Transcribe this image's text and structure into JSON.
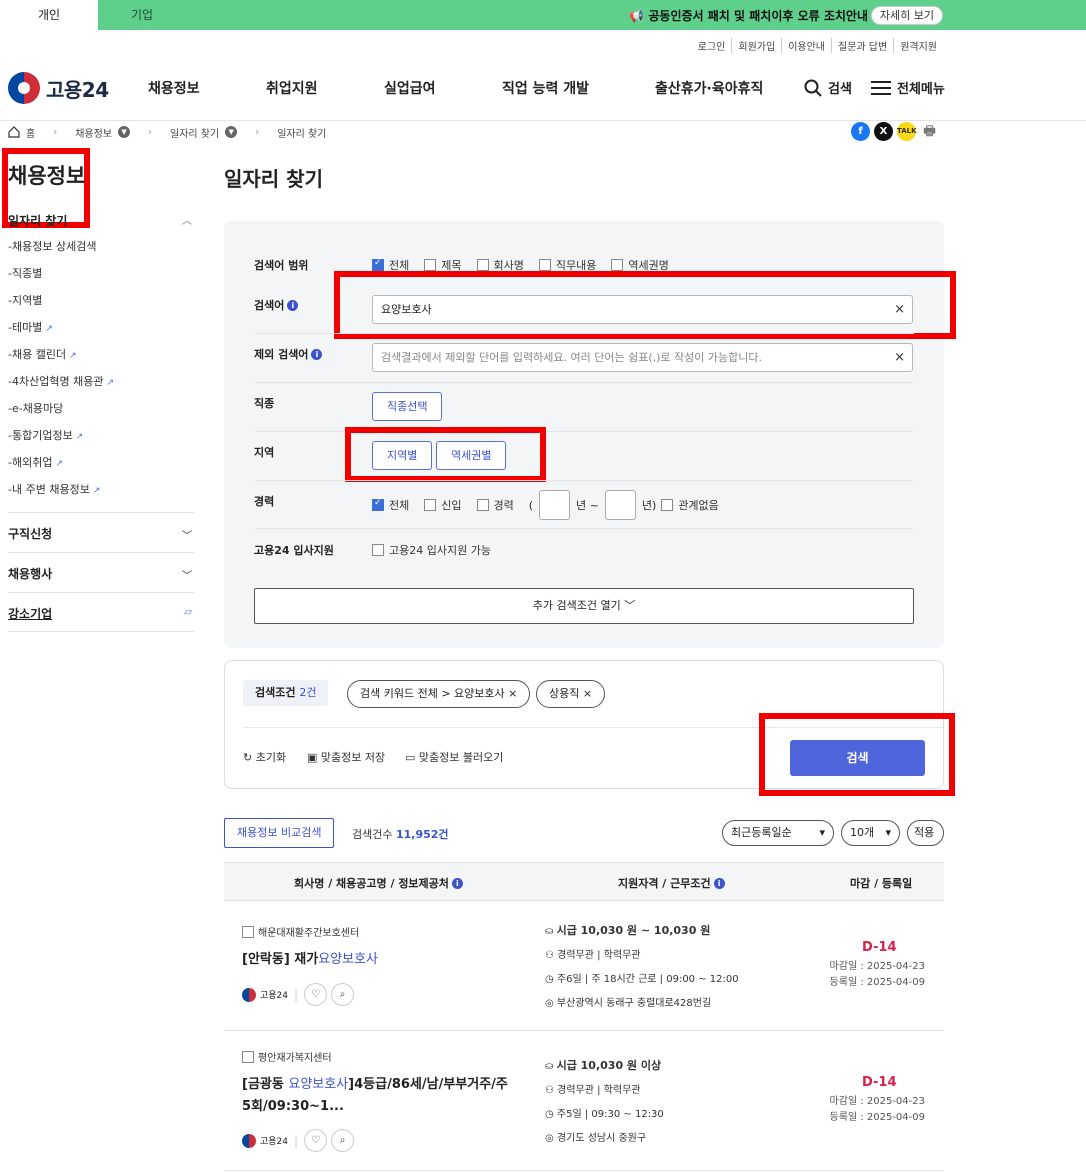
{
  "topbar": {
    "tabs": [
      "개인",
      "기업"
    ],
    "notice": "📢 공동인증서 패치 및 패치이후 오류 조치안내",
    "notice_button": "자세히 보기"
  },
  "util_links": [
    "로그인",
    "회원가입",
    "이용안내",
    "질문과 답변",
    "원격지원"
  ],
  "logo": "고용24",
  "nav": [
    "채용정보",
    "취업지원",
    "실업급여",
    "직업 능력 개발",
    "출산휴가·육아휴직"
  ],
  "nav_search": "검색",
  "nav_menu": "전체메뉴",
  "breadcrumb": [
    "홈",
    "채용정보",
    "일자리 찾기",
    "일자리 찾기"
  ],
  "sidebar": {
    "title": "채용정보",
    "current": "일자리 찾기",
    "items": [
      "채용정보 상세검색",
      "직종별",
      "지역별",
      "테마별",
      "채용 캘린더",
      "4차산업혁명 채용관",
      "e-채용마당",
      "통합기업정보",
      "해외취업",
      "내 주변 채용정보"
    ],
    "sections": [
      "구직신청",
      "채용행사",
      "강소기업"
    ]
  },
  "page_title": "일자리 찾기",
  "form": {
    "scope_label": "검색어 범위",
    "scope_options": [
      "전체",
      "제목",
      "회사명",
      "직무내용",
      "역세권명"
    ],
    "keyword_label": "검색어",
    "keyword_value": "요양보호사",
    "exclude_label": "제외 검색어",
    "exclude_placeholder": "검색결과에서 제외할 단어를 입력하세요. 여러 단어는 쉼표(,)로 작성이 가능합니다.",
    "job_label": "직종",
    "job_button": "직종선택",
    "region_label": "지역",
    "region_buttons": [
      "지역별",
      "역세권별"
    ],
    "career_label": "경력",
    "career_options": [
      "전체",
      "신입",
      "경력"
    ],
    "year_text": "년 ~",
    "year_close": "년)",
    "no_matter": "관계없음",
    "support_label": "고용24 입사지원",
    "support_option": "고용24 입사지원 가능",
    "more_button": "추가 검색조건 열기"
  },
  "conditions": {
    "label": "검색조건",
    "count": "2건",
    "chips": [
      "검색 키워드 전체 > 요양보호사",
      "상용직"
    ],
    "actions": [
      "초기화",
      "맞춤정보 저장",
      "맞춤정보 불러오기"
    ],
    "search_button": "검색"
  },
  "results": {
    "compare_button": "채용정보 비교검색",
    "count_label": "검색건수",
    "count_value": "11,952건",
    "sort": "최근등록일순",
    "page_size": "10개",
    "apply": "적용",
    "headers": [
      "회사명 / 채용공고명 / 정보제공처",
      "지원자격 / 근무조건",
      "마감 / 등록일"
    ]
  },
  "jobs": [
    {
      "company": "해운대재활주간보호센터",
      "title_prefix": "[안락동] 재가",
      "title_highlight": "요양보호사",
      "title_suffix": "",
      "wage": "시급 10,030 원 ~ 10,030 원",
      "qual": "경력무관  |  학력무관",
      "hours": "주6일  |  주 18시간 근로  |  09:00 ~ 12:00",
      "location": "부산광역시 동래구 충렬대로428번길",
      "dday": "D-14",
      "deadline": "마감일 : 2025-04-23",
      "registered": "등록일 : 2025-04-09",
      "source": "고용24"
    },
    {
      "company": "평안재가복지센터",
      "title_prefix": "[금광동 ",
      "title_highlight": "요양보호사",
      "title_suffix": "]4등급/86세/남/부부거주/주5회/09:30~1...",
      "wage": "시급 10,030 원 이상",
      "qual": "경력무관  |  학력무관",
      "hours": "주5일  |  09:30 ~ 12:30",
      "location": "경기도 성남시 중원구",
      "dday": "D-14",
      "deadline": "마감일 : 2025-04-23",
      "registered": "등록일 : 2025-04-09",
      "source": "고용24"
    }
  ],
  "colors": {
    "banner": "#5fcf8c",
    "accent": "#4f65dc",
    "highlight_box": "#f20000",
    "dday": "#d6214b"
  }
}
